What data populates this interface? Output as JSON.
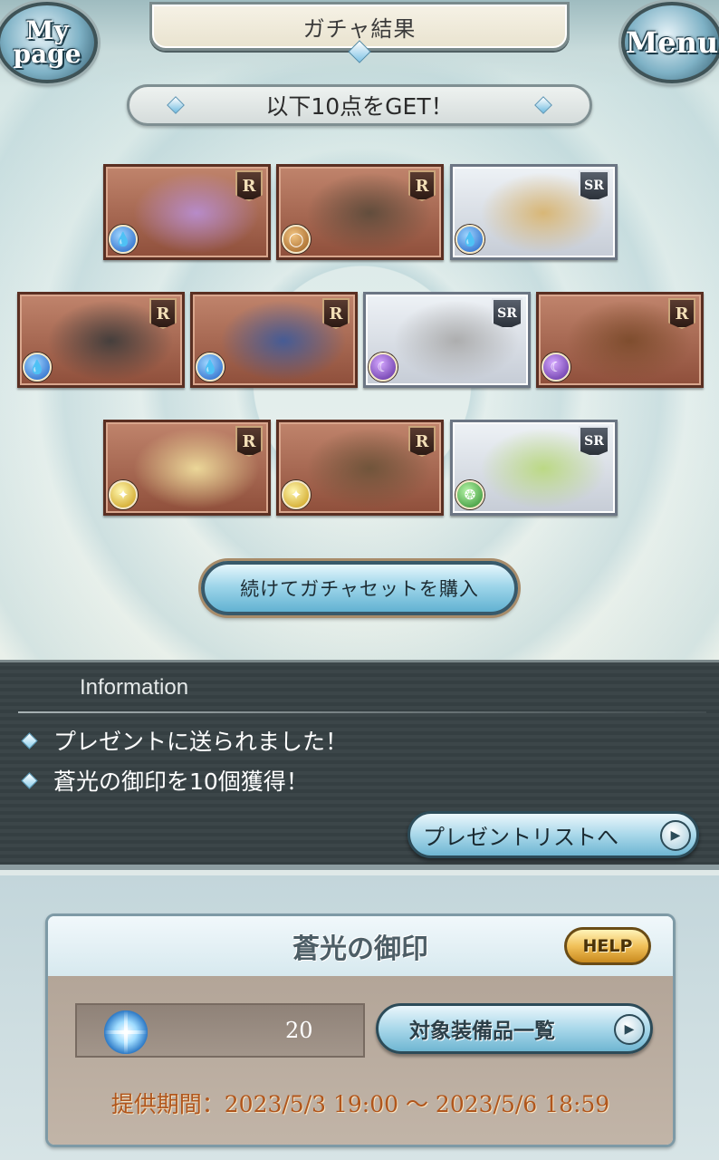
{
  "header": {
    "title": "ガチャ結果",
    "mypage_label": "My page",
    "menu_label": "Menu"
  },
  "get_banner": "以下10点をGET！",
  "items": [
    {
      "rarity": "R",
      "element": "water",
      "kind": "character",
      "color": "#b98fd6"
    },
    {
      "rarity": "R",
      "element": "earth",
      "kind": "summon",
      "color": "#5a4a3a"
    },
    {
      "rarity": "SR",
      "element": "water",
      "kind": "spear",
      "color": "#d8b26a"
    },
    {
      "rarity": "R",
      "element": "water",
      "kind": "katana",
      "color": "#3a3a3a"
    },
    {
      "rarity": "R",
      "element": "water",
      "kind": "staff",
      "color": "#3b5a9c"
    },
    {
      "rarity": "SR",
      "element": "dark",
      "kind": "katana",
      "color": "#a8a8a8"
    },
    {
      "rarity": "R",
      "element": "dark",
      "kind": "summon",
      "color": "#7a4a2a"
    },
    {
      "rarity": "R",
      "element": "light",
      "kind": "summon",
      "color": "#f3e3a0"
    },
    {
      "rarity": "R",
      "element": "light",
      "kind": "axe",
      "color": "#6a5238"
    },
    {
      "rarity": "SR",
      "element": "wind",
      "kind": "character",
      "color": "#b8d87a"
    }
  ],
  "buy_button": "続けてガチャセットを購入",
  "information": {
    "title": "Information",
    "lines": [
      "プレゼントに送られました！",
      "蒼光の御印を10個獲得！"
    ],
    "present_button": "プレゼントリストへ"
  },
  "seal": {
    "title": "蒼光の御印",
    "help_label": "HELP",
    "count": "20",
    "equip_button": "対象装備品一覧",
    "period": "提供期間：2023/5/3 19:00 〜 2023/5/6 18:59"
  }
}
